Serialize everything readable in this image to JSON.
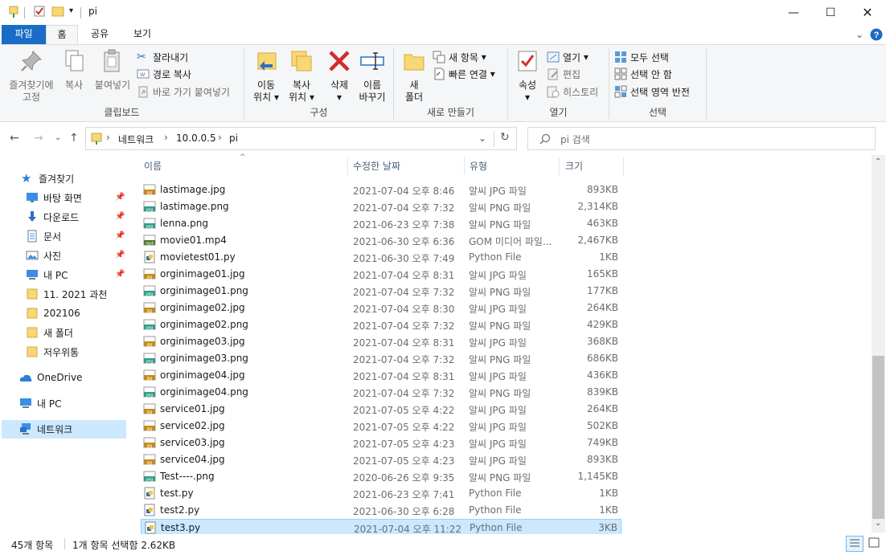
{
  "window": {
    "title": "pi"
  },
  "ribbon_tabs": {
    "file": "파일",
    "home": "홈",
    "share": "공유",
    "view": "보기"
  },
  "clipboard": {
    "pin": "즐겨찾기에",
    "pin2": "고정",
    "copy": "복사",
    "paste": "붙여넣기",
    "cut": "잘라내기",
    "copy_path": "경로 복사",
    "paste_shortcut": "바로 가기 붙여넣기",
    "label": "클립보드"
  },
  "organize": {
    "move": "이동",
    "move2": "위치",
    "copy": "복사",
    "copy2": "위치",
    "delete": "삭제",
    "rename": "이름",
    "rename2": "바꾸기",
    "label": "구성"
  },
  "newgroup": {
    "new_folder": "새",
    "new_folder2": "폴더",
    "new_item": "새 항목",
    "easy_access": "빠른 연결",
    "label": "새로 만들기"
  },
  "opengroup": {
    "properties": "속성",
    "open": "열기",
    "edit": "편집",
    "history": "히스토리",
    "label": "열기"
  },
  "select": {
    "all": "모두 선택",
    "none": "선택 안 함",
    "invert": "선택 영역 반전",
    "label": "선택"
  },
  "address": {
    "crumb1": "네트워크",
    "crumb2": "10.0.0.5",
    "crumb3": "pi"
  },
  "search": {
    "placeholder": "pi 검색"
  },
  "nav": {
    "quick_access": "즐겨찾기",
    "desktop": "바탕 화면",
    "downloads": "다운로드",
    "documents": "문서",
    "pictures": "사진",
    "mypc_pinned": "내 PC",
    "folder1": "11. 2021 과천",
    "folder2": "202106",
    "folder3": "새 폴더",
    "folder4": "저우위통",
    "onedrive": "OneDrive",
    "thispc": "내 PC",
    "network": "네트워크"
  },
  "columns": {
    "name": "이름",
    "date": "수정한 날짜",
    "type": "유형",
    "size": "크기"
  },
  "files": [
    {
      "name": "lastimage.jpg",
      "date": "2021-07-04 오후 8:46",
      "type": "알씨 JPG 파일",
      "size": "893KB",
      "icon": "jpg"
    },
    {
      "name": "lastimage.png",
      "date": "2021-07-04 오후 7:32",
      "type": "알씨 PNG 파일",
      "size": "2,314KB",
      "icon": "png"
    },
    {
      "name": "lenna.png",
      "date": "2021-06-23 오후 7:38",
      "type": "알씨 PNG 파일",
      "size": "463KB",
      "icon": "png"
    },
    {
      "name": "movie01.mp4",
      "date": "2021-06-30 오후 6:36",
      "type": "GOM 미디어 파일...",
      "size": "2,467KB",
      "icon": "mp4"
    },
    {
      "name": "movietest01.py",
      "date": "2021-06-30 오후 7:49",
      "type": "Python File",
      "size": "1KB",
      "icon": "py"
    },
    {
      "name": "orginimage01.jpg",
      "date": "2021-07-04 오후 8:31",
      "type": "알씨 JPG 파일",
      "size": "165KB",
      "icon": "jpg"
    },
    {
      "name": "orginimage01.png",
      "date": "2021-07-04 오후 7:32",
      "type": "알씨 PNG 파일",
      "size": "177KB",
      "icon": "png"
    },
    {
      "name": "orginimage02.jpg",
      "date": "2021-07-04 오후 8:30",
      "type": "알씨 JPG 파일",
      "size": "264KB",
      "icon": "jpg"
    },
    {
      "name": "orginimage02.png",
      "date": "2021-07-04 오후 7:32",
      "type": "알씨 PNG 파일",
      "size": "429KB",
      "icon": "png"
    },
    {
      "name": "orginimage03.jpg",
      "date": "2021-07-04 오후 8:31",
      "type": "알씨 JPG 파일",
      "size": "368KB",
      "icon": "jpg"
    },
    {
      "name": "orginimage03.png",
      "date": "2021-07-04 오후 7:32",
      "type": "알씨 PNG 파일",
      "size": "686KB",
      "icon": "png"
    },
    {
      "name": "orginimage04.jpg",
      "date": "2021-07-04 오후 8:31",
      "type": "알씨 JPG 파일",
      "size": "436KB",
      "icon": "jpg"
    },
    {
      "name": "orginimage04.png",
      "date": "2021-07-04 오후 7:32",
      "type": "알씨 PNG 파일",
      "size": "839KB",
      "icon": "png"
    },
    {
      "name": "service01.jpg",
      "date": "2021-07-05 오후 4:22",
      "type": "알씨 JPG 파일",
      "size": "264KB",
      "icon": "jpg"
    },
    {
      "name": "service02.jpg",
      "date": "2021-07-05 오후 4:22",
      "type": "알씨 JPG 파일",
      "size": "502KB",
      "icon": "jpg"
    },
    {
      "name": "service03.jpg",
      "date": "2021-07-05 오후 4:23",
      "type": "알씨 JPG 파일",
      "size": "749KB",
      "icon": "jpg"
    },
    {
      "name": "service04.jpg",
      "date": "2021-07-05 오후 4:23",
      "type": "알씨 JPG 파일",
      "size": "893KB",
      "icon": "jpg"
    },
    {
      "name": "Test----.png",
      "date": "2020-06-26 오후 9:35",
      "type": "알씨 PNG 파일",
      "size": "1,145KB",
      "icon": "png"
    },
    {
      "name": "test.py",
      "date": "2021-06-23 오후 7:41",
      "type": "Python File",
      "size": "1KB",
      "icon": "py"
    },
    {
      "name": "test2.py",
      "date": "2021-06-30 오후 6:28",
      "type": "Python File",
      "size": "1KB",
      "icon": "py"
    },
    {
      "name": "test3.py",
      "date": "2021-07-04 오후 11:22",
      "type": "Python File",
      "size": "3KB",
      "icon": "py",
      "selected": true
    }
  ],
  "status": {
    "count": "45개 항목",
    "selection": "1개 항목 선택함 2.62KB"
  },
  "colors": {
    "accent": "#1a6cc6",
    "selection": "#cce8ff",
    "folder": "#f8d775"
  }
}
